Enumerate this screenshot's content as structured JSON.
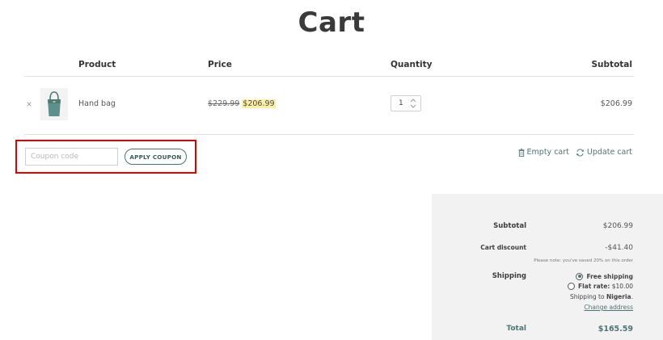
{
  "page": {
    "title": "Cart"
  },
  "table": {
    "headers": {
      "product": "Product",
      "price": "Price",
      "quantity": "Quantity",
      "subtotal": "Subtotal"
    },
    "row": {
      "remove": "×",
      "product_name": "Hand bag",
      "price_old": "$229.99",
      "price_new": "$206.99",
      "quantity": "1",
      "subtotal": "$206.99"
    }
  },
  "coupon": {
    "placeholder": "Coupon code",
    "value": "",
    "apply_label": "APPLY COUPON"
  },
  "actions": {
    "empty_cart": "Empty cart",
    "update_cart": "Update cart"
  },
  "totals": {
    "subtotal_label": "Subtotal",
    "subtotal_value": "$206.99",
    "discount_label": "Cart discount",
    "discount_value": "-$41.40",
    "discount_note": "Please note: you've saved 20% on this order",
    "shipping_label": "Shipping",
    "options": [
      {
        "label": "Free shipping",
        "price": "",
        "selected": true
      },
      {
        "label": "Flat rate:",
        "price": "$10.00",
        "selected": false
      }
    ],
    "shipping_to_prefix": "Shipping to ",
    "shipping_country": "Nigeria",
    "shipping_to_suffix": ".",
    "change_address": "Change address",
    "total_label": "Total",
    "total_value": "$165.59"
  },
  "colors": {
    "accent": "#4f7474",
    "highlight_box": "#e00000",
    "sale_highlight": "#fdf0a6",
    "totals_bg": "#f2f2f2"
  },
  "icons": {
    "remove": "close-icon",
    "empty_cart": "trash-icon",
    "update_cart": "refresh-icon",
    "quantity": "stepper-icon"
  }
}
